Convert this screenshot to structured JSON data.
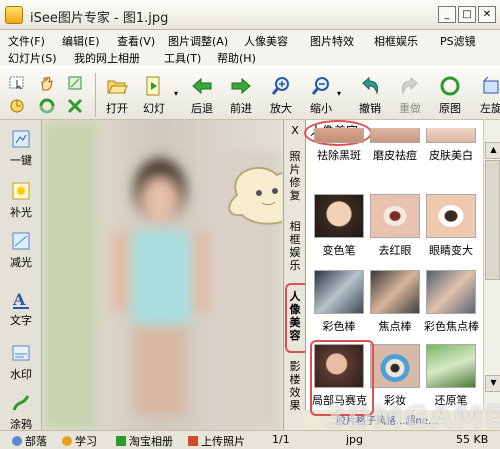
{
  "window": {
    "title": "iSee图片专家 - 图1.jpg"
  },
  "menu": [
    "文件(F)",
    "编辑(E)",
    "查看(V)",
    "图片调整(A)",
    "人像美容",
    "图片特效",
    "相框娱乐",
    "PS滤镜",
    "幻灯片(S)",
    "我的网上相册",
    "工具(T)",
    "帮助(H)"
  ],
  "toolbar": {
    "buttons": [
      "打开",
      "幻灯",
      "后退",
      "前进",
      "放大",
      "缩小",
      "撤销",
      "重做",
      "原图",
      "左旋"
    ]
  },
  "leftbar": {
    "tools": [
      "一键",
      "补光",
      "减光",
      "文字",
      "水印",
      "涂鸦"
    ]
  },
  "tabs": {
    "close": "X",
    "items": [
      "照片修复",
      "相框娱乐",
      "人像美容",
      "影楼效果"
    ]
  },
  "panel": {
    "title": "人像美容",
    "effects": [
      "祛除黑斑",
      "磨皮祛痘",
      "皮肤美白",
      "变色笔",
      "去红眼",
      "眼睛变大",
      "彩色棒",
      "焦点棒",
      "彩色焦点棒",
      "局部马赛克",
      "彩妆",
      "还原笔"
    ],
    "footer": "胶片格子风格...超ne..."
  },
  "status": {
    "items": [
      "部落",
      "学习",
      "淘宝相册",
      "上传照片"
    ],
    "page": "1/1",
    "format": "jpg",
    "size": "55 KB"
  },
  "watermark": "3DMGAME",
  "colors": {
    "highlight": "#e05050",
    "accent_green": "#2e9a2e"
  }
}
